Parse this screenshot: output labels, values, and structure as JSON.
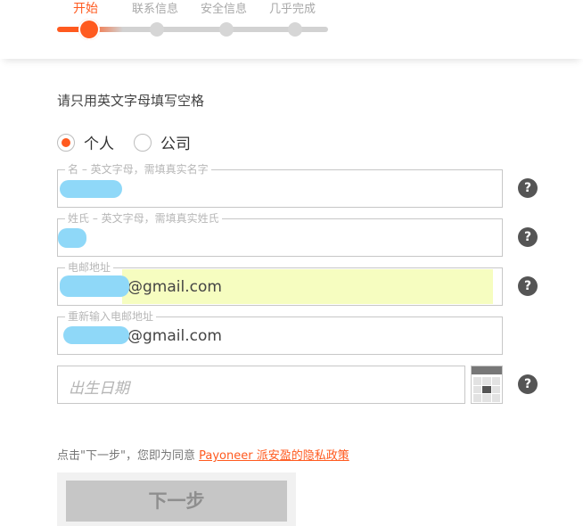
{
  "stepper": {
    "steps": [
      {
        "label": "开始",
        "active": true
      },
      {
        "label": "联系信息",
        "active": false
      },
      {
        "label": "安全信息",
        "active": false
      },
      {
        "label": "几乎完成",
        "active": false
      }
    ],
    "accent_color": "#ff5a1f"
  },
  "form": {
    "instruction": "请只用英文字母填写空格",
    "account_type": {
      "options": [
        "个人",
        "公司"
      ],
      "selected": "个人"
    },
    "first_name": {
      "label": "名 – 英文字母，需填真实名字",
      "value": ""
    },
    "last_name": {
      "label": "姓氏 – 英文字母，需填真实姓氏",
      "value": ""
    },
    "email": {
      "label": "电邮地址",
      "value": "@gmail.com"
    },
    "email_confirm": {
      "label": "重新输入电邮地址",
      "value": "@gmail.com"
    },
    "birth_date": {
      "placeholder": "出生日期"
    },
    "help_icon": "?",
    "consent": {
      "prefix": "点击\"下一步\"，您即为同意",
      "link": "Payoneer 派安盈的隐私政策"
    },
    "next_button": "下一步"
  }
}
